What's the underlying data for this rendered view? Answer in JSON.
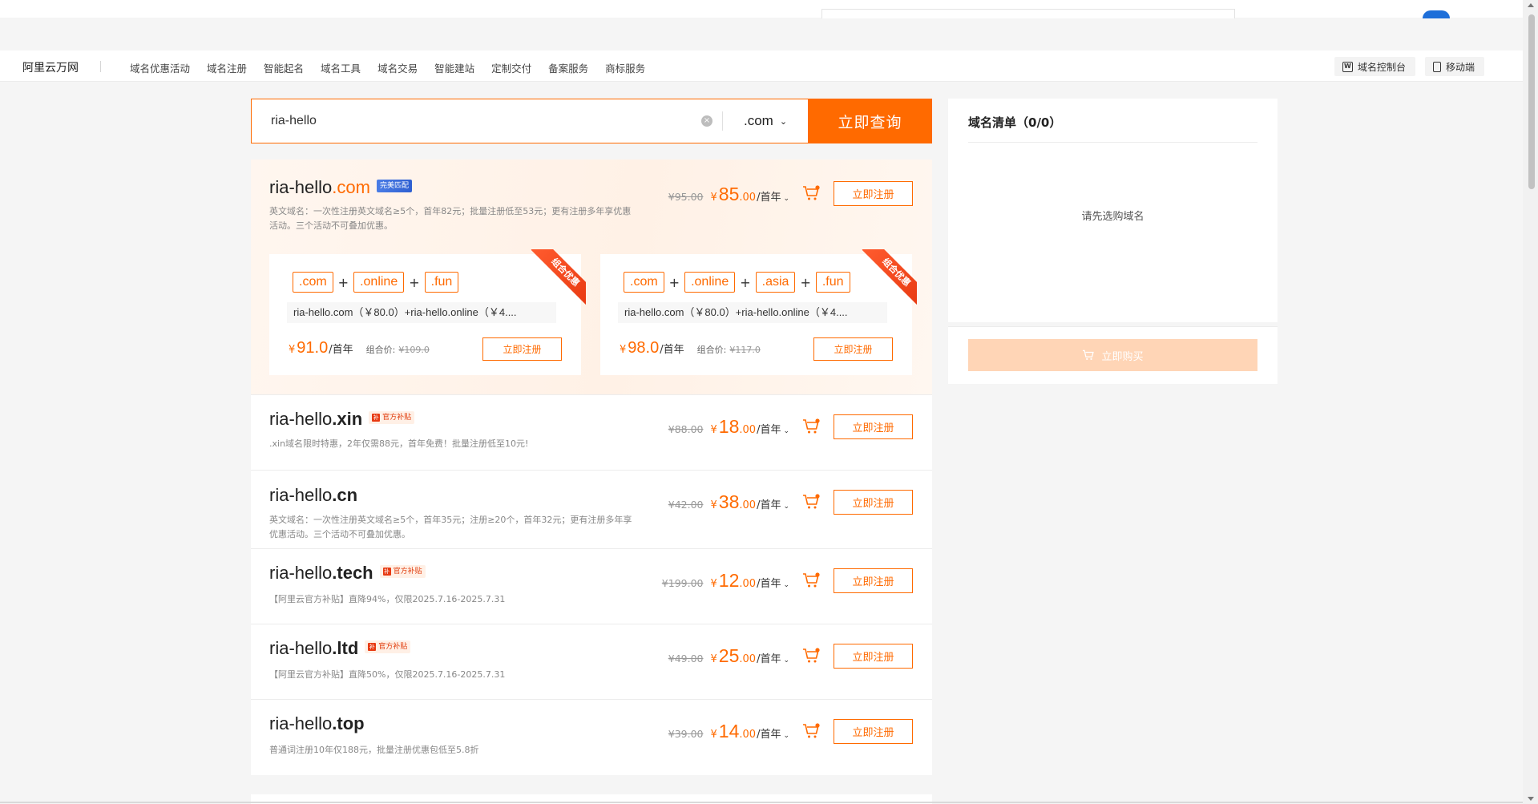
{
  "nav": {
    "brand": "阿里云万网",
    "links": [
      "域名优惠活动",
      "域名注册",
      "智能起名",
      "域名工具",
      "域名交易",
      "智能建站",
      "定制交付",
      "备案服务",
      "商标服务"
    ],
    "console": "域名控制台",
    "mobile": "移动端"
  },
  "search": {
    "value": "ria-hello",
    "suffix": ".com",
    "button": "立即查询"
  },
  "featured": {
    "name": "ria-hello",
    "tld": ".com",
    "badge": "完美匹配",
    "desc": "英文域名：一次性注册英文域名≥5个，首年82元；批量注册低至53元；更有注册多年享优惠活动。三个活动不可叠加优惠。",
    "old_price": "¥95.00",
    "symbol": "¥",
    "price_int": "85",
    "price_dec": ".00",
    "period": "/首年",
    "register": "立即注册",
    "combos": [
      {
        "ribbon": "组合优惠",
        "tags": [
          ".com",
          ".online",
          ".fun"
        ],
        "desc": "ria-hello.com（￥80.0）+ria-hello.online（￥4....",
        "symbol": "¥",
        "price": "91.0",
        "period": "/首年",
        "label": "组合价:",
        "old": "¥109.0",
        "register": "立即注册"
      },
      {
        "ribbon": "组合优惠",
        "tags": [
          ".com",
          ".online",
          ".asia",
          ".fun"
        ],
        "desc": "ria-hello.com（￥80.0）+ria-hello.online（￥4....",
        "symbol": "¥",
        "price": "98.0",
        "period": "/首年",
        "label": "组合价:",
        "old": "¥117.0",
        "register": "立即注册"
      }
    ]
  },
  "rows": [
    {
      "name": "ria-hello",
      "tld": ".xin",
      "badge": "官方补贴",
      "desc": ".xin域名限时特惠，2年仅需88元，首年免费！批量注册低至10元!",
      "old_price": "¥88.00",
      "symbol": "¥",
      "price_int": "18",
      "price_dec": ".00",
      "period": "/首年",
      "register": "立即注册"
    },
    {
      "name": "ria-hello",
      "tld": ".cn",
      "badge": "",
      "desc": "英文域名：一次性注册英文域名≥5个，首年35元；注册≥20个，首年32元；更有注册多年享优惠活动。三个活动不可叠加优惠。",
      "old_price": "¥42.00",
      "symbol": "¥",
      "price_int": "38",
      "price_dec": ".00",
      "period": "/首年",
      "register": "立即注册"
    },
    {
      "name": "ria-hello",
      "tld": ".tech",
      "badge": "官方补贴",
      "desc": "【阿里云官方补贴】直降94%，仅限2025.7.16-2025.7.31",
      "old_price": "¥199.00",
      "symbol": "¥",
      "price_int": "12",
      "price_dec": ".00",
      "period": "/首年",
      "register": "立即注册"
    },
    {
      "name": "ria-hello",
      "tld": ".ltd",
      "badge": "官方补贴",
      "desc": "【阿里云官方补贴】直降50%，仅限2025.7.16-2025.7.31",
      "old_price": "¥49.00",
      "symbol": "¥",
      "price_int": "25",
      "price_dec": ".00",
      "period": "/首年",
      "register": "立即注册"
    },
    {
      "name": "ria-hello",
      "tld": ".top",
      "badge": "",
      "desc": "普通词注册10年仅188元，批量注册优惠包低至5.8折",
      "old_price": "¥39.00",
      "symbol": "¥",
      "price_int": "14",
      "price_dec": ".00",
      "period": "/首年",
      "register": "立即注册"
    }
  ],
  "list": {
    "title": "域名清单（0/0）",
    "empty": "请先选购域名",
    "buy": "立即购买"
  },
  "colors": {
    "accent": "#ff6a00",
    "buy_disabled": "#ffd5b6",
    "match_badge": "#2f5fd1"
  },
  "icons": {
    "cart": "shopping-cart-icon",
    "clear": "clear-circle-icon",
    "chevron": "chevron-down-icon",
    "console": "console-icon",
    "mobile": "mobile-icon"
  }
}
